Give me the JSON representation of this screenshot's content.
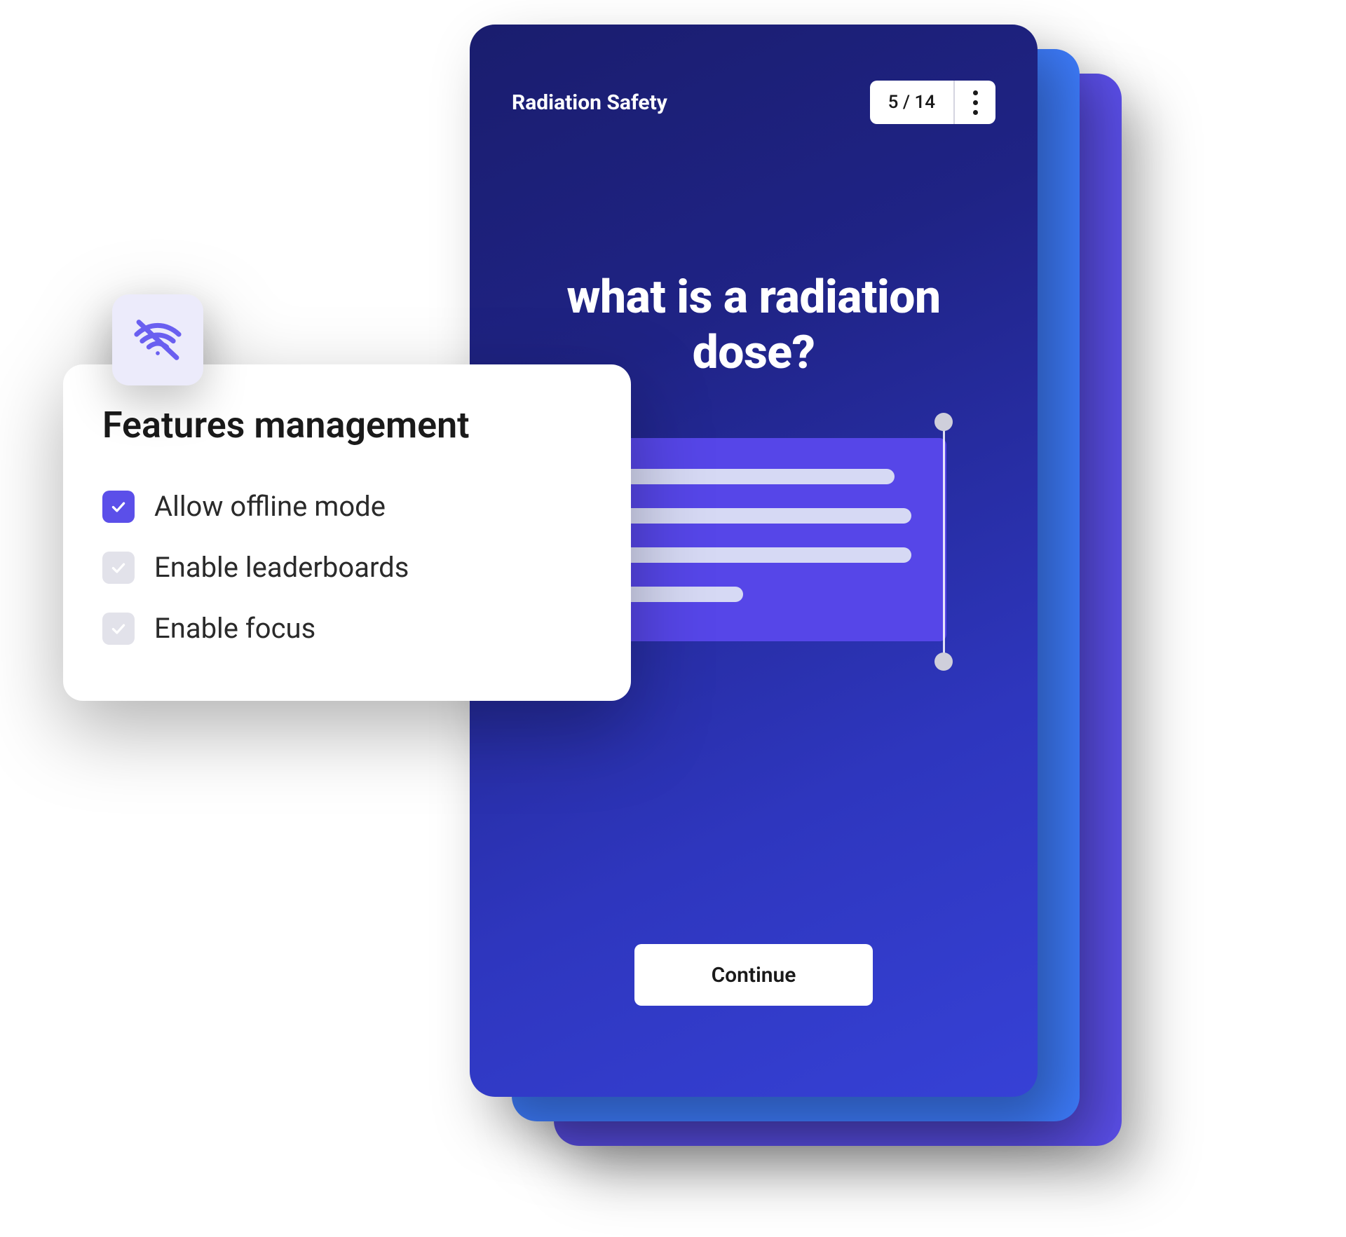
{
  "phone": {
    "title": "Radiation Safety",
    "counter": "5 / 14",
    "question": "what is a radiation dose?",
    "continue_label": "Continue"
  },
  "features": {
    "title": "Features management",
    "items": [
      {
        "label": "Allow offline mode",
        "checked": true
      },
      {
        "label": "Enable leaderboards",
        "checked": false
      },
      {
        "label": "Enable focus",
        "checked": false
      }
    ]
  },
  "colors": {
    "accent": "#5B4FE9",
    "phone_gradient_start": "#1a1d6e",
    "phone_gradient_end": "#3641d6",
    "stack_blue": "#3D7BFA"
  }
}
